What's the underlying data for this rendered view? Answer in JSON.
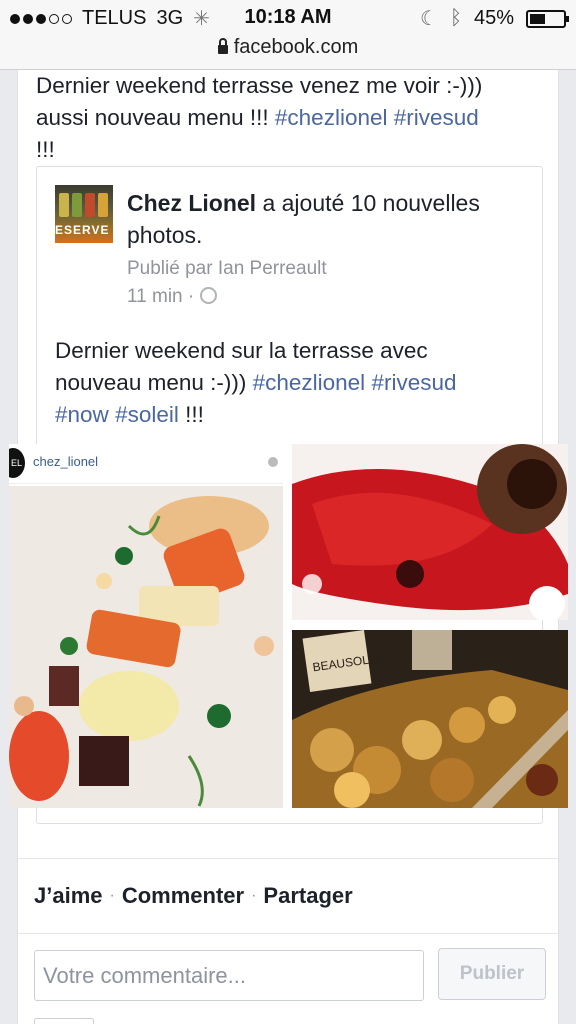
{
  "status_bar": {
    "carrier": "TELUS",
    "network": "3G",
    "time": "10:18 AM",
    "battery": "45%",
    "battery_level": 0.45,
    "signal_bars_filled": 3,
    "signal_bars_total": 5
  },
  "browser": {
    "url": "facebook.com"
  },
  "post": {
    "text_line1": "Dernier weekend terrasse venez me voir :-)))",
    "text_line2_prefix": "aussi nouveau menu !!! ",
    "hashtag1": "#chezlionel",
    "hashtag2": "#rivesud",
    "text_suffix": "!!!"
  },
  "shared": {
    "avatar_text": "ESERVE",
    "page_name": "Chez Lionel",
    "action_text": " a ajouté 10 nouvelles photos.",
    "published_by_label": "Publié par",
    "published_by_name": "Ian Perreault",
    "time": "11 min",
    "separator": "·",
    "text_line1": "Dernier weekend sur la terrasse avec",
    "text_line2_prefix": "nouveau menu :-))) ",
    "hashtag1": "#chezlionel",
    "hashtag2": "#rivesud",
    "hashtag3": "#now",
    "hashtag4": "#soleil",
    "text_suffix": "!!!"
  },
  "photos": {
    "instagram_avatar_text": "EL",
    "instagram_user": "chez_lionel",
    "photo3_sign": "BEAUSOLEIL"
  },
  "actions": {
    "like": "J’aime",
    "comment": "Commenter",
    "share": "Partager",
    "dot": "·"
  },
  "comment_box": {
    "placeholder": "Votre commentaire...",
    "publish_label": "Publier"
  },
  "colors": {
    "hashtag": "#4b67a1",
    "meta": "#90949c",
    "text": "#1d2129"
  }
}
